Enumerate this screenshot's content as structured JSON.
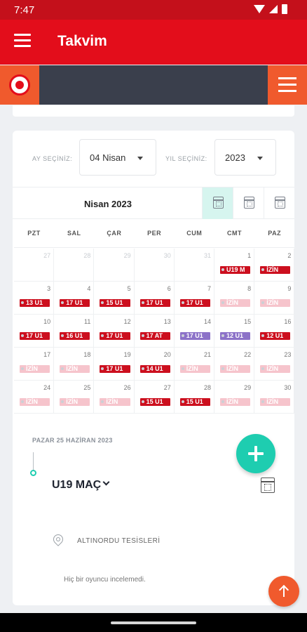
{
  "status_bar": {
    "time": "7:47"
  },
  "app_bar": {
    "title": "Takvim"
  },
  "selectors": {
    "month_label": "AY SEÇİNİZ:",
    "month_value": "04 Nisan",
    "year_label": "YIL SEÇİNİZ:",
    "year_value": "2023"
  },
  "calendar": {
    "month_title": "Nisan 2023",
    "weekdays": [
      "PZT",
      "SAL",
      "ÇAR",
      "PER",
      "CUM",
      "CMT",
      "PAZ"
    ],
    "weeks": [
      [
        {
          "day": "27",
          "other": true
        },
        {
          "day": "28",
          "other": true
        },
        {
          "day": "29",
          "other": true
        },
        {
          "day": "30",
          "other": true
        },
        {
          "day": "31",
          "other": true
        },
        {
          "day": "1",
          "event": "U19 M",
          "kind": "match"
        },
        {
          "day": "2",
          "event": "İZİN",
          "kind": "match"
        }
      ],
      [
        {
          "day": "3",
          "event": "13 U1",
          "kind": "match"
        },
        {
          "day": "4",
          "event": "17 U1",
          "kind": "match"
        },
        {
          "day": "5",
          "event": "15 U1",
          "kind": "match"
        },
        {
          "day": "6",
          "event": "17 U1",
          "kind": "match"
        },
        {
          "day": "7",
          "event": "17 U1",
          "kind": "match"
        },
        {
          "day": "8",
          "event": "İZİN",
          "kind": "off"
        },
        {
          "day": "9",
          "event": "İZİN",
          "kind": "off"
        }
      ],
      [
        {
          "day": "10",
          "event": "17 U1",
          "kind": "match"
        },
        {
          "day": "11",
          "event": "16 U1",
          "kind": "match"
        },
        {
          "day": "12",
          "event": "17 U1",
          "kind": "match"
        },
        {
          "day": "13",
          "event": "17 AT",
          "kind": "match"
        },
        {
          "day": "14",
          "event": "17 U1",
          "kind": "purple"
        },
        {
          "day": "15",
          "event": "12 U1",
          "kind": "purple"
        },
        {
          "day": "16",
          "event": "12 U1",
          "kind": "match"
        }
      ],
      [
        {
          "day": "17",
          "event": "İZİN",
          "kind": "off"
        },
        {
          "day": "18",
          "event": "İZİN",
          "kind": "off"
        },
        {
          "day": "19",
          "event": "17 U1",
          "kind": "match"
        },
        {
          "day": "20",
          "event": "14 U1",
          "kind": "match"
        },
        {
          "day": "21",
          "event": "İZİN",
          "kind": "off"
        },
        {
          "day": "22",
          "event": "İZİN",
          "kind": "off"
        },
        {
          "day": "23",
          "event": "İZİN",
          "kind": "off"
        }
      ],
      [
        {
          "day": "24",
          "event": "İZİN",
          "kind": "off"
        },
        {
          "day": "25",
          "event": "İZİN",
          "kind": "off"
        },
        {
          "day": "26",
          "event": "İZİN",
          "kind": "off"
        },
        {
          "day": "27",
          "event": "15 U1",
          "kind": "match"
        },
        {
          "day": "28",
          "event": "15 U1",
          "kind": "match"
        },
        {
          "day": "29",
          "event": "İZİN",
          "kind": "off"
        },
        {
          "day": "30",
          "event": "İZİN",
          "kind": "off"
        }
      ]
    ]
  },
  "day_detail": {
    "date": "PAZAR 25 HAZİRAN 2023",
    "event_title": "U19 MAÇ",
    "location": "ALTINORDU TESİSLERİ",
    "note": "Hiç bir oyuncu incelemedi."
  },
  "colors": {
    "brand_red": "#e30d1b",
    "accent_orange": "#f05a2d",
    "accent_teal": "#1ecdb0",
    "header_dark": "#3a3f4c"
  }
}
